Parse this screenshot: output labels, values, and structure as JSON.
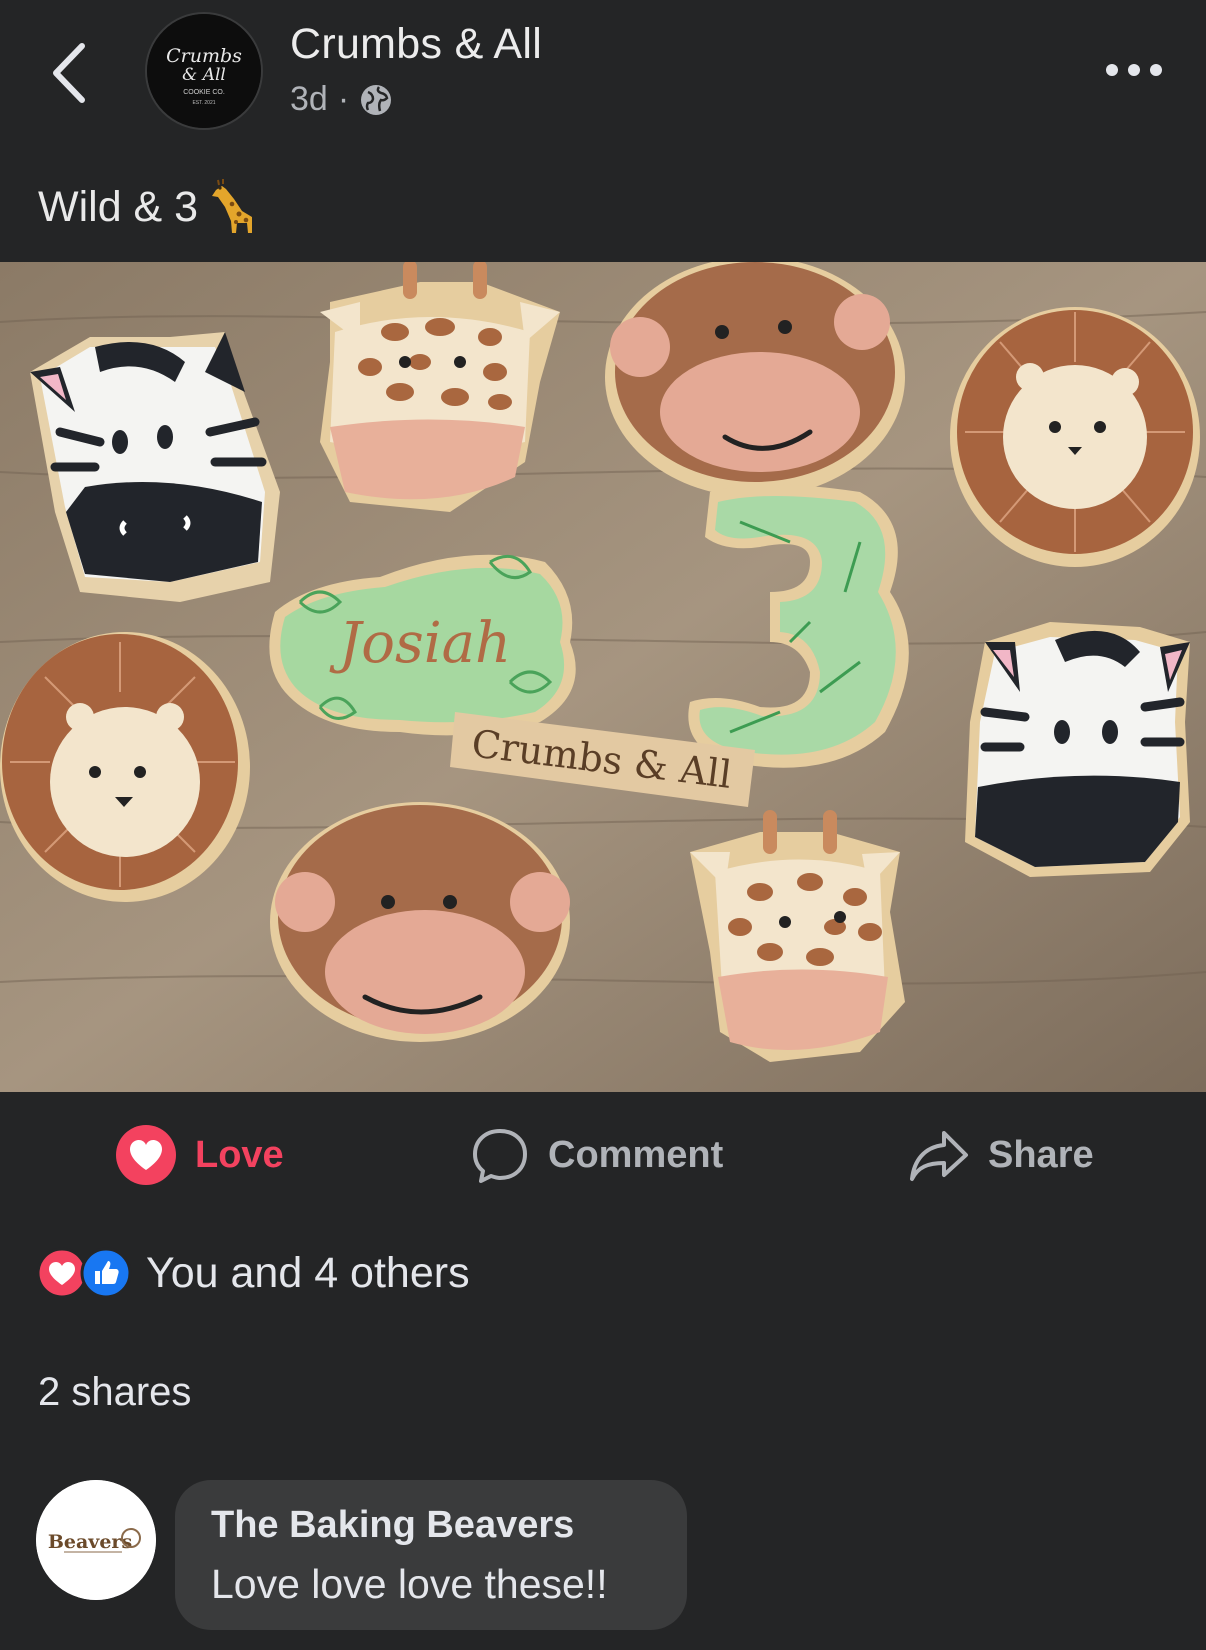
{
  "header": {
    "page_name": "Crumbs & All",
    "time": "3d",
    "separator": "·",
    "privacy_icon": "globe-icon",
    "avatar_text": {
      "line1": "Crumbs",
      "line2": "& All",
      "line3": "COOKIE CO.",
      "line4": "EST. 2021"
    }
  },
  "post": {
    "caption": "Wild & 3",
    "caption_emoji": "giraffe"
  },
  "photo": {
    "josiah_text": "Josiah",
    "plaque_text": "Crumbs & All",
    "number_text": "3"
  },
  "actions": {
    "love_label": "Love",
    "comment_label": "Comment",
    "share_label": "Share",
    "love_color": "#f3425f",
    "like_color": "#1877f2"
  },
  "reactions": {
    "text": "You and 4 others"
  },
  "shares": {
    "text": "2 shares"
  },
  "comment": {
    "author": "The Baking Beavers",
    "text": "Love love love these!!",
    "avatar_text": "Beavers"
  }
}
